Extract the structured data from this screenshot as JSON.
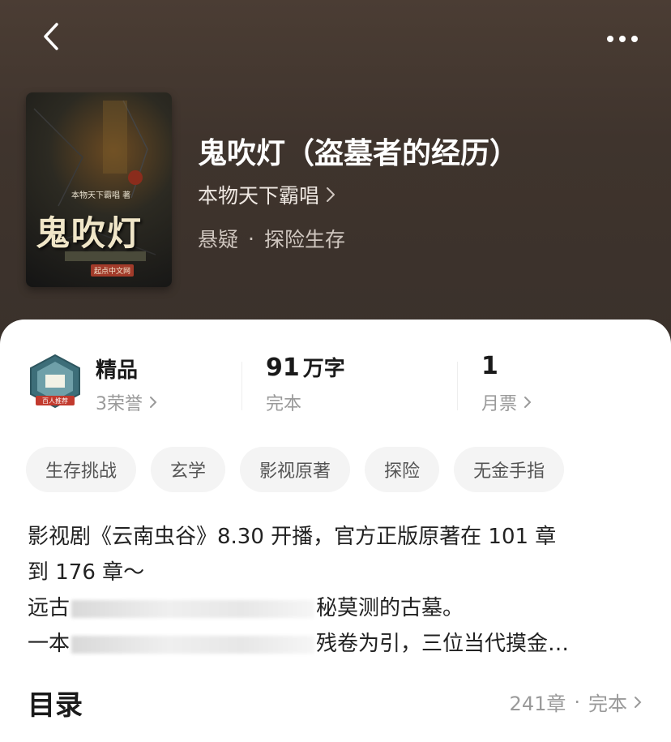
{
  "nav": {
    "back_icon": "chevron-left-icon",
    "more_icon": "more-horizontal-icon"
  },
  "book": {
    "title": "鬼吹灯（盗墓者的经历）",
    "author": "本物天下霸唱",
    "genres": [
      "悬疑",
      "探险生存"
    ],
    "genre_separator": "·",
    "cover": {
      "author_text": "本物天下霸唱 著",
      "title_text": "鬼吹灯",
      "publisher_text": "起点中文网"
    }
  },
  "stats": {
    "level": {
      "value": "精品",
      "sub": "3荣誉",
      "badge_text": "百人推荐"
    },
    "words": {
      "value": "91",
      "unit": "万字",
      "sub": "完本"
    },
    "tickets": {
      "value": "1",
      "sub": "月票"
    }
  },
  "tags": [
    "生存挑战",
    "玄学",
    "影视原著",
    "探险",
    "无金手指"
  ],
  "description": {
    "line1": "影视剧《云南虫谷》8.30 开播，官方正版原著在 101 章",
    "line2": "到 176 章～",
    "line3_start": "远古",
    "line3_end": "秘莫测的古墓。",
    "line4_start": "一本",
    "line4_end": "残卷为引，三位当代摸金…"
  },
  "toc": {
    "title": "目录",
    "chapters": "241章",
    "status": "完本"
  },
  "colors": {
    "hero_bg": "#4b3d34",
    "card_bg": "#ffffff",
    "tag_bg": "#f4f4f4"
  }
}
